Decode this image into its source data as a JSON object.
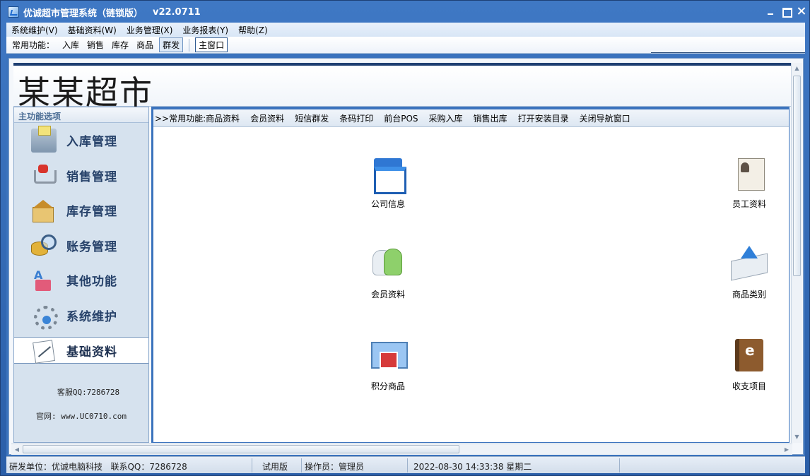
{
  "window": {
    "title": "优诚超市管理系统（链锁版）",
    "version": "v22.0711"
  },
  "menu": [
    "系统维护(V)",
    "基础资料(W)",
    "业务管理(X)",
    "业务报表(Y)",
    "帮助(Z)"
  ],
  "toolbar": {
    "label": "常用功能：",
    "buttons": [
      "入库",
      "销售",
      "库存",
      "商品"
    ],
    "active_button": "群发",
    "main_window": "主窗口"
  },
  "banner": {
    "title": "某某超市"
  },
  "sidebar": {
    "header": "主功能选项",
    "items": [
      {
        "label": "入库管理",
        "icon": "cash-register-icon"
      },
      {
        "label": "销售管理",
        "icon": "shopping-cart-icon"
      },
      {
        "label": "库存管理",
        "icon": "warehouse-icon"
      },
      {
        "label": "账务管理",
        "icon": "coins-magnifier-icon"
      },
      {
        "label": "其他功能",
        "icon": "shapes-icon"
      },
      {
        "label": "系统维护",
        "icon": "gear-icon"
      },
      {
        "label": "基础资料",
        "icon": "notepad-icon"
      }
    ],
    "selected": "基础资料",
    "qq": "客服QQ:7286728",
    "website": "官网: www.UC0710.com"
  },
  "quickbar": {
    "label": ">>常用功能:",
    "links": [
      "商品资料",
      "会员资料",
      "短信群发",
      "条码打印",
      "前台POS",
      "采购入库",
      "销售出库",
      "打开安装目录",
      "关闭导航窗口"
    ]
  },
  "tiles": [
    {
      "label": "公司信息",
      "icon": "store-icon"
    },
    {
      "label": "员工资料",
      "icon": "staff-card-icon"
    },
    {
      "label": "会员资料",
      "icon": "members-icon"
    },
    {
      "label": "商品类别",
      "icon": "category-arrow-icon"
    },
    {
      "label": "积分商品",
      "icon": "gift-icon"
    },
    {
      "label": "收支项目",
      "icon": "ledger-book-icon"
    }
  ],
  "status": {
    "developer": "研发单位：优诚电脑科技",
    "contact": "联系QQ：7286728",
    "edition": "试用版",
    "operator": "操作员：管理员",
    "datetime": "2022-08-30 14:33:38 星期二"
  }
}
